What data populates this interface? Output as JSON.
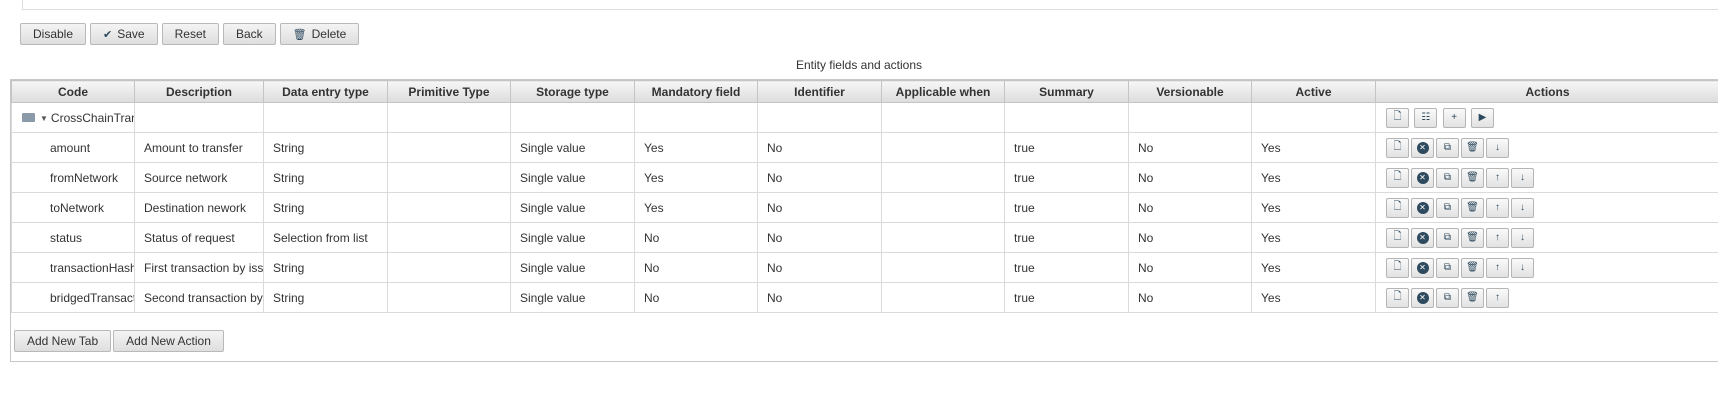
{
  "toolbar": {
    "disable_label": "Disable",
    "save_label": "Save",
    "reset_label": "Reset",
    "back_label": "Back",
    "delete_label": "Delete"
  },
  "section_title": "Entity fields and actions",
  "table": {
    "headers": [
      "Code",
      "Description",
      "Data entry type",
      "Primitive Type",
      "Storage type",
      "Mandatory field",
      "Identifier",
      "Applicable when",
      "Summary",
      "Versionable",
      "Active",
      "Actions"
    ],
    "root_label": "CrossChainTrans",
    "rows": [
      {
        "code": "amount",
        "description": "Amount to transfer",
        "data_entry_type": "String",
        "primitive_type": "",
        "storage_type": "Single value",
        "mandatory": "Yes",
        "identifier": "No",
        "applicable_when": "",
        "summary": "true",
        "versionable": "No",
        "active": "Yes"
      },
      {
        "code": "fromNetwork",
        "description": "Source network",
        "data_entry_type": "String",
        "primitive_type": "",
        "storage_type": "Single value",
        "mandatory": "Yes",
        "identifier": "No",
        "applicable_when": "",
        "summary": "true",
        "versionable": "No",
        "active": "Yes"
      },
      {
        "code": "toNetwork",
        "description": "Destination nework",
        "data_entry_type": "String",
        "primitive_type": "",
        "storage_type": "Single value",
        "mandatory": "Yes",
        "identifier": "No",
        "applicable_when": "",
        "summary": "true",
        "versionable": "No",
        "active": "Yes"
      },
      {
        "code": "status",
        "description": "Status of request",
        "data_entry_type": "Selection from list",
        "primitive_type": "",
        "storage_type": "Single value",
        "mandatory": "No",
        "identifier": "No",
        "applicable_when": "",
        "summary": "true",
        "versionable": "No",
        "active": "Yes"
      },
      {
        "code": "transactionHash",
        "description": "First transaction by issu",
        "data_entry_type": "String",
        "primitive_type": "",
        "storage_type": "Single value",
        "mandatory": "No",
        "identifier": "No",
        "applicable_when": "",
        "summary": "true",
        "versionable": "No",
        "active": "Yes"
      },
      {
        "code": "bridgedTransacti",
        "description": "Second transaction by n",
        "data_entry_type": "String",
        "primitive_type": "",
        "storage_type": "Single value",
        "mandatory": "No",
        "identifier": "No",
        "applicable_when": "",
        "summary": "true",
        "versionable": "No",
        "active": "Yes"
      }
    ]
  },
  "bottom": {
    "add_tab_label": "Add New Tab",
    "add_action_label": "Add New Action"
  },
  "icons": {
    "save": "checkmark-icon",
    "delete": "trash-icon",
    "root_folder": "folder-icon",
    "root_caret": "caret-down-icon"
  },
  "colors": {
    "icon": "#2e4a5e",
    "header_bg": "#dcdcdc",
    "border": "#c8c8c8"
  }
}
